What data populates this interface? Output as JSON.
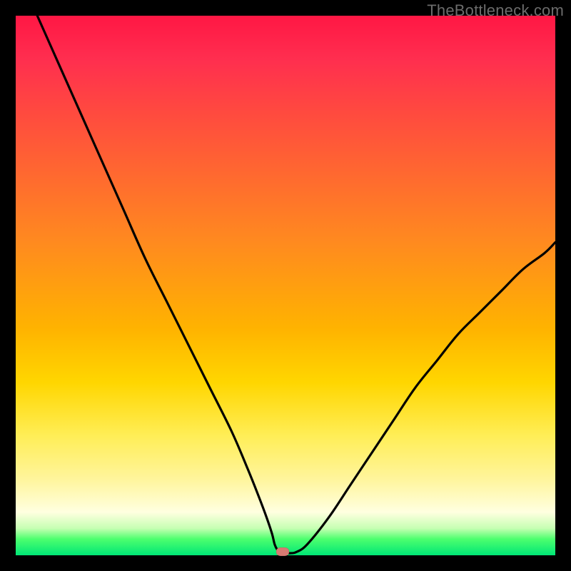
{
  "watermark": "TheBottleneck.com",
  "colors": {
    "frame": "#000000",
    "curve_stroke": "#000000",
    "marker_fill": "#d77a72"
  },
  "chart_data": {
    "type": "line",
    "title": "",
    "xlabel": "",
    "ylabel": "",
    "xlim": [
      0,
      100
    ],
    "ylim": [
      0,
      100
    ],
    "grid": false,
    "legend": false,
    "series": [
      {
        "name": "bottleneck-curve",
        "x": [
          4,
          8,
          12,
          16,
          20,
          24,
          28,
          32,
          36,
          40,
          43,
          45,
          46.5,
          47.5,
          48,
          48.5,
          49,
          50,
          51,
          52,
          54,
          58,
          62,
          66,
          70,
          74,
          78,
          82,
          86,
          90,
          94,
          98,
          100
        ],
        "y": [
          100,
          91,
          82,
          73,
          64,
          55,
          47,
          39,
          31,
          23,
          16,
          11,
          7,
          4,
          2,
          1,
          0.5,
          0.4,
          0.4,
          0.6,
          2,
          7,
          13,
          19,
          25,
          31,
          36,
          41,
          45,
          49,
          53,
          56,
          58
        ]
      }
    ],
    "marker": {
      "x": 49.5,
      "y": 0.6
    },
    "notes": "x and y are in percent of the plot area; (0,0) is bottom-left. Values are visually estimated from the image since no axes/ticks are present."
  }
}
